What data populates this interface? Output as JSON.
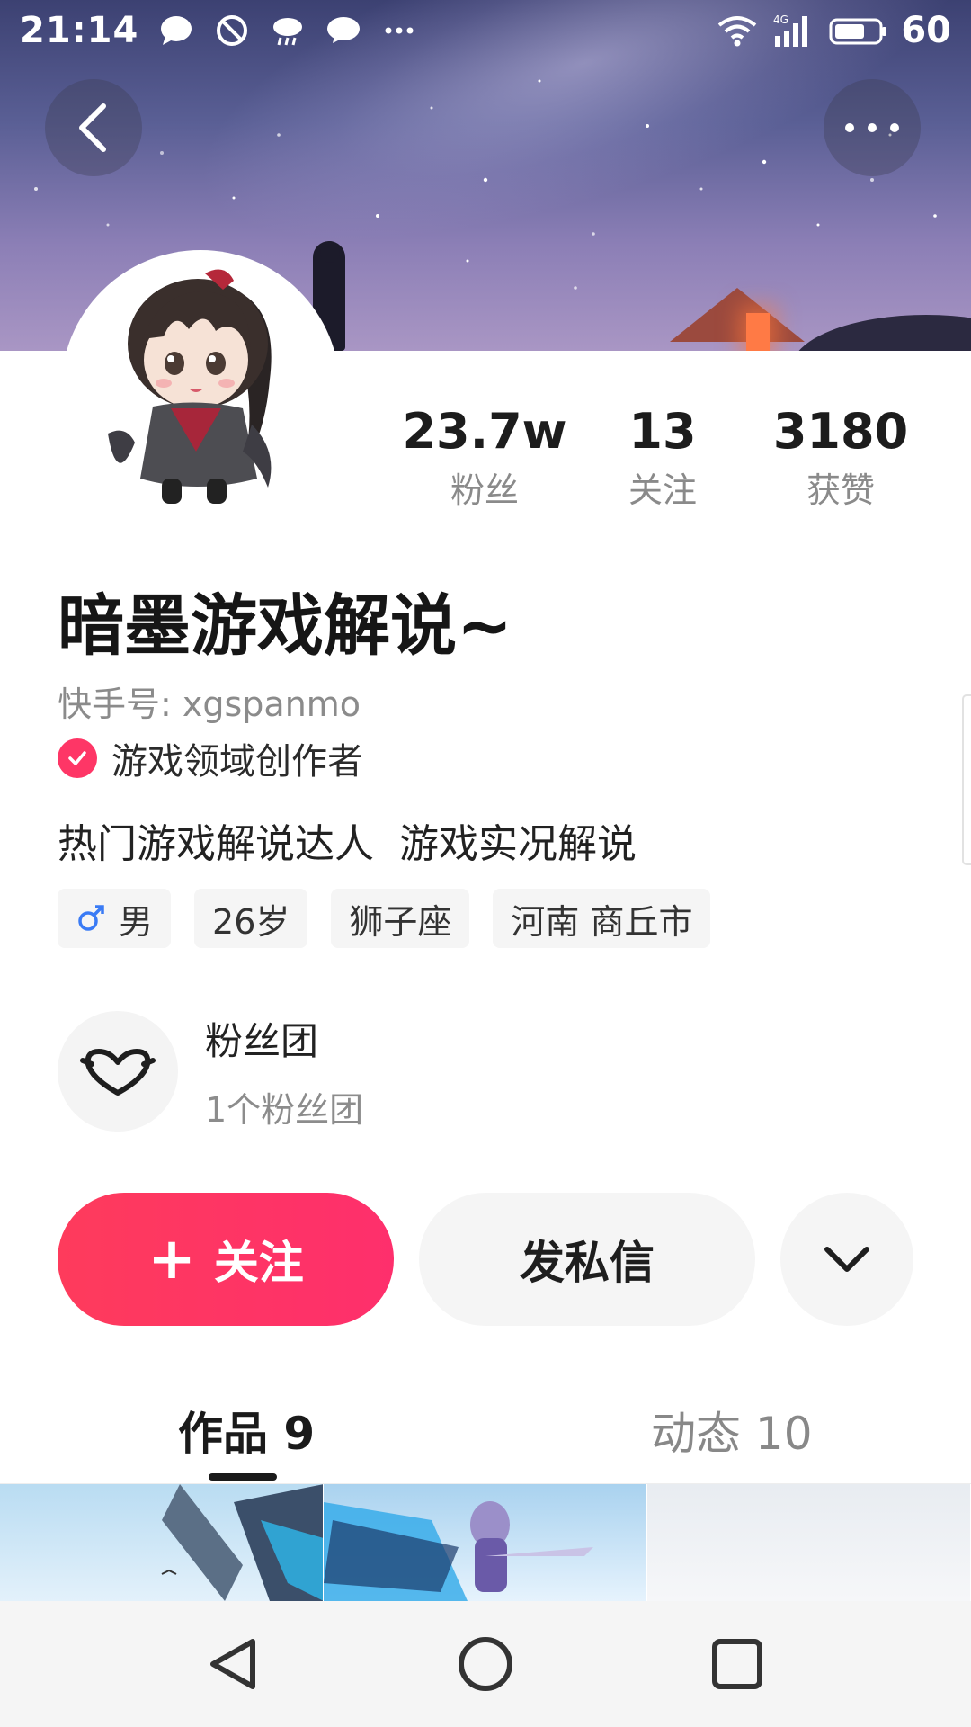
{
  "status_bar": {
    "time": "21:14",
    "network": "4G",
    "battery_level": "60",
    "notification_icons": [
      "chat-bubble-icon",
      "do-not-disturb-icon",
      "weather-icon",
      "message-icon",
      "more-dots-icon"
    ]
  },
  "profile": {
    "name": "暗墨游戏解说~",
    "kuaishou_id": "快手号: xgspanmo",
    "certification": "游戏领域创作者",
    "bio": "热门游戏解说达人  游戏实况解说",
    "stats": [
      {
        "value": "23.7w",
        "label": "粉丝"
      },
      {
        "value": "13",
        "label": "关注"
      },
      {
        "value": "3180",
        "label": "获赞"
      }
    ],
    "tags": {
      "gender": "男",
      "age": "26岁",
      "zodiac": "狮子座",
      "location": "河南 商丘市"
    }
  },
  "fan_club": {
    "title": "粉丝团",
    "subtitle": "1个粉丝团"
  },
  "actions": {
    "follow": "关注",
    "message": "发私信"
  },
  "tabs": [
    {
      "label": "作品 9",
      "active": true
    },
    {
      "label": "动态 10",
      "active": false
    }
  ],
  "colors": {
    "accent": "#fe3666",
    "secondary_button_bg": "#f5f5f5",
    "male_icon": "#3a7bf5"
  }
}
